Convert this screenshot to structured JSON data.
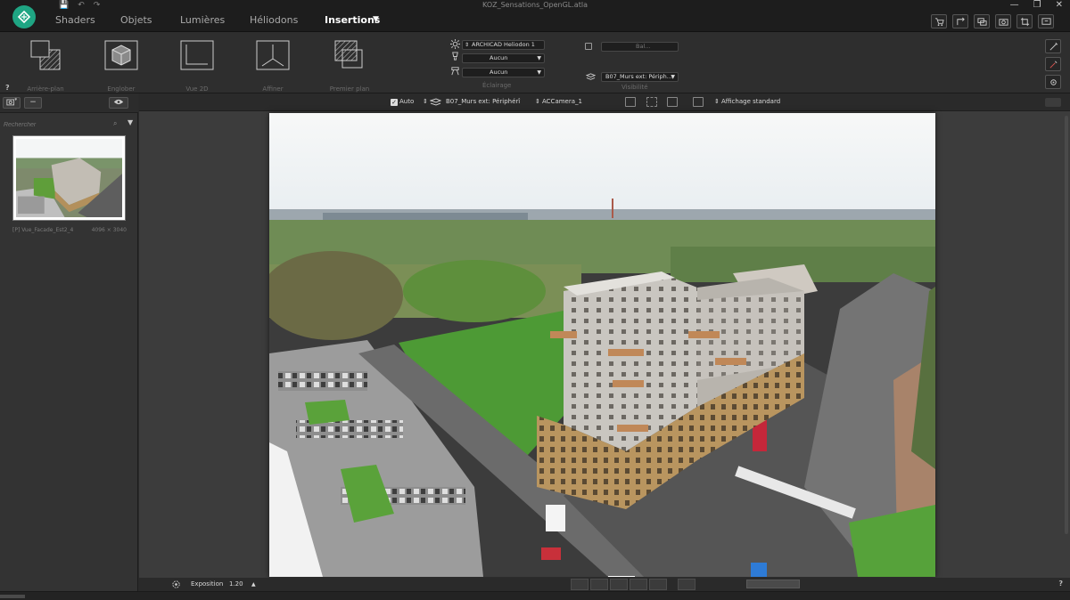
{
  "app": {
    "window_title": "KOZ_Sensations_OpenGL.atla",
    "quick_access": [
      "💾",
      "↶",
      "↷"
    ],
    "window_controls": [
      "—",
      "❐",
      "✕"
    ]
  },
  "tabs": [
    {
      "label": "Shaders"
    },
    {
      "label": "Objets"
    },
    {
      "label": "Lumières"
    },
    {
      "label": "Héliodons"
    },
    {
      "label": "Insertions"
    }
  ],
  "active_tab": "Insertions",
  "tab_dropdown_arrow": "▼",
  "ribbon": {
    "buttons": [
      {
        "label": "Arrière-plan",
        "icon": "background-icon"
      },
      {
        "label": "Englober",
        "icon": "cube-icon"
      },
      {
        "label": "Vue 2D",
        "icon": "axes-2d-icon"
      },
      {
        "label": "Affiner",
        "icon": "axes-3d-icon"
      },
      {
        "label": "Premier plan",
        "icon": "foreground-icon"
      }
    ],
    "eclairage": {
      "heliodon": "ARCHICAD Heliodon 1",
      "lamp": "Aucun",
      "spot": "Aucun",
      "label": "Éclairage"
    },
    "visibilite": {
      "toggle_value": "Bal...",
      "layer": "B07_Murs ext: Périph...",
      "label": "Visibilité"
    },
    "help": "?"
  },
  "left_panel": {
    "remove_label": "−",
    "search_placeholder": "Rechercher",
    "search_icon": "⌕",
    "dropdown_arrow": "▼",
    "thumbnail": {
      "caption": "[P] Vue_Facade_Est2_4",
      "size": "4096 × 3040"
    }
  },
  "viewport_toolbar": {
    "auto_label": "Auto",
    "layer": "B07_Murs ext: Périphérî",
    "camera": "ACCamera_1",
    "display_mode": "Affichage standard",
    "checkmark": "✓",
    "spin": "⇕"
  },
  "bottom_bar": {
    "exposition_label": "Exposition",
    "exposition_value": "1.20",
    "up_arrow": "▲",
    "help": "?"
  },
  "colors": {
    "accent": "#1fa583",
    "panel": "#333333",
    "viewport_bg": "#3c3c3c"
  }
}
